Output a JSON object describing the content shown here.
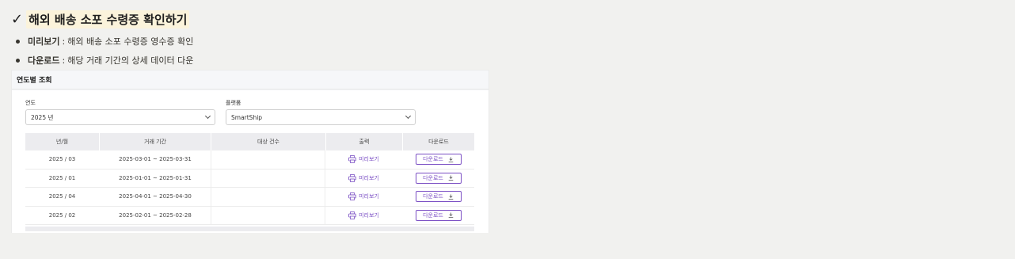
{
  "heading": {
    "check": "✓",
    "title": "해외 배송 소포 수령증 확인하기"
  },
  "bullets": [
    {
      "term": "미리보기",
      "sep": ":",
      "desc": "해외 배송 소포 수령증 영수증 확인"
    },
    {
      "term": "다운로드",
      "sep": ":",
      "desc": "해당 거래 기간의 상세 데이터 다운"
    }
  ],
  "panel": {
    "title": "연도별 조회",
    "year_label": "연도",
    "year_value": "2025 년",
    "platform_label": "플랫폼",
    "platform_value": "SmartShip"
  },
  "table": {
    "headers": [
      "년/월",
      "거래 기간",
      "대상 건수",
      "출력",
      "다운로드"
    ],
    "rows": [
      {
        "month": "2025 / 03",
        "period": "2025-03-01 ~ 2025-03-31",
        "count": "",
        "preview": "미리보기",
        "download": "다운로드"
      },
      {
        "month": "2025 / 01",
        "period": "2025-01-01 ~ 2025-01-31",
        "count": "",
        "preview": "미리보기",
        "download": "다운로드"
      },
      {
        "month": "2025 / 04",
        "period": "2025-04-01 ~ 2025-04-30",
        "count": "",
        "preview": "미리보기",
        "download": "다운로드"
      },
      {
        "month": "2025 / 02",
        "period": "2025-02-01 ~ 2025-02-28",
        "count": "",
        "preview": "미리보기",
        "download": "다운로드"
      }
    ]
  },
  "icons": {
    "preview": "printer-icon",
    "download": "download-icon",
    "select": "chevron-down-icon"
  },
  "colors": {
    "accent": "#7b4fc4",
    "highlight": "#fbf3db"
  }
}
